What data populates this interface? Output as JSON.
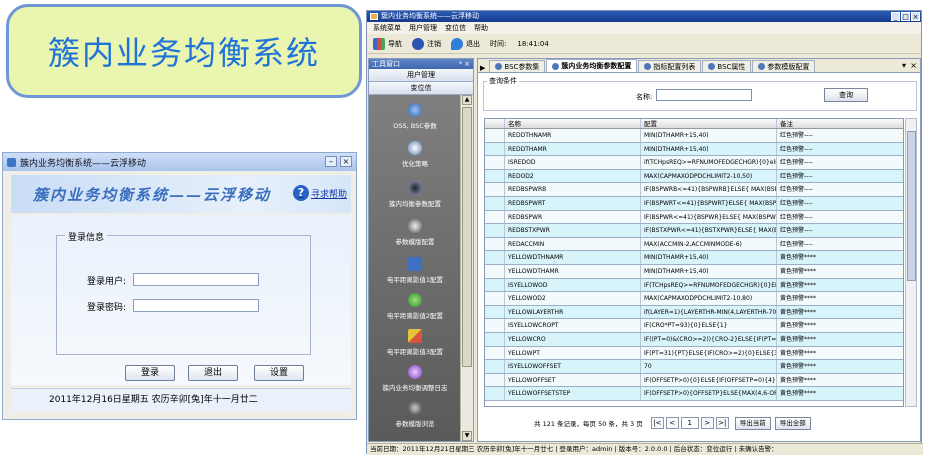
{
  "banner": {
    "title": "簇内业务均衡系统"
  },
  "login": {
    "window_title": "簇内业务均衡系统——云浮移动",
    "header_title": "簇内业务均衡系统——云浮移动",
    "help_label": "寻求帮助",
    "group_title": "登录信息",
    "user_label": "登录用户:",
    "password_label": "登录密码:",
    "buttons": {
      "login": "登录",
      "exit": "退出",
      "settings": "设置"
    },
    "footer_date": "2011年12月16日星期五 农历辛卯[兔]年十一月廿二"
  },
  "main": {
    "window_title": "簇内业务均衡系统——云浮移动",
    "menu": [
      "系统菜单",
      "用户管理",
      "变位信",
      "帮助"
    ],
    "toolbar": {
      "nav": "导航",
      "logout": "注销",
      "exit": "退出",
      "time_label": "时间:",
      "time_value": "18:41:04"
    },
    "sidebar": {
      "header": "工具窗口",
      "tab1": "用户管理",
      "tab2": "变位信",
      "items": [
        "OSS, BSC参数",
        "优化策略",
        "簇内均衡参数配置",
        "参数模版配置",
        "电平距离影值1配置",
        "电平距离影值2配置",
        "电平距离影值3配置",
        "簇内业务均衡调整日志",
        "参数模版浏览"
      ]
    },
    "tabs": [
      "BSC参数集",
      "簇内业务均衡参数配置",
      "指标配置列表",
      "BSC属性",
      "参数模版配置"
    ],
    "query": {
      "legend": "查询条件",
      "name_label": "名称:",
      "button": "查询"
    },
    "columns": [
      "名称",
      "配置",
      "备注"
    ],
    "rows": [
      [
        "REDDTHNAMR",
        "MIN(DTHAMR+15,40)",
        "红色预警----"
      ],
      [
        "REDDTHAMR",
        "MIN(DTHAMR+15,40)",
        "红色预警----"
      ],
      [
        "ISREDOD",
        "if(TCHpsREQ>=RFNUMOFEDGECHGR){0}else{1}",
        "红色预警----"
      ],
      [
        "REDOD2",
        "MAX(CAPMAXODPDCHLIMIT2-10,50)",
        "红色预警----"
      ],
      [
        "REDBSPWRB",
        "IF(BSPWRB<=41){BSPWRB}ELSE{ MAX(BSPW...",
        "红色预警----"
      ],
      [
        "REDBSPWRT",
        "IF(BSPWRT<=41){BSPWRT}ELSE{ MAX(BSPW...",
        "红色预警----"
      ],
      [
        "REDBSPWR",
        "IF(BSPWR<=41){BSPWR}ELSE{ MAX(BSPWR-...",
        "红色预警----"
      ],
      [
        "REDBSTXPWR",
        "IF(BSTXPWR<=41){BSTXPWR}ELSE{ MAX(BST...",
        "红色预警----"
      ],
      [
        "REDACCMIN",
        "MAX(ACCMIN-2,ACCMINMODE-6)",
        "红色预警----"
      ],
      [
        "YELLOWDTHNAMR",
        "MIN(DTHAMR+15,40)",
        "黄色预警****"
      ],
      [
        "YELLOWDTHAMR",
        "MIN(DTHAMR+15,40)",
        "黄色预警****"
      ],
      [
        "ISYELLOWOD",
        "IF(TCHpsREQ>=RFNUMOFEDGECHGR){0}ELS...",
        "黄色预警****"
      ],
      [
        "YELLOWOD2",
        "MAX(CAPMAXODPDCHLIMIT2-10,80)",
        "黄色预警****"
      ],
      [
        "YELLOWLAYERTHR",
        "if(LAYER=1){LAYERTHR-MIN(4,LAYERTHR-70)...",
        "黄色预警****"
      ],
      [
        "ISYELLOWCROPT",
        "IF(CRO*PT=93){0}ELSE{1}",
        "黄色预警****"
      ],
      [
        "YELLOWCRO",
        "IF((PT=0)&(CRO>=2)){CRO-2}ELSE{IF(PT=0)...",
        "黄色预警****"
      ],
      [
        "YELLOWPT",
        "IF(PT=31){PT}ELSE{IF(CRO>=2){0}ELSE{31}}",
        "黄色预警****"
      ],
      [
        "ISYELLOWOFFSET",
        "70",
        "黄色预警****"
      ],
      [
        "YELLOWOFFSET",
        "IF(OFFSETP>0){0}ELSE{IF(OFFSETP=0){4}EL...",
        "黄色预警****"
      ],
      [
        "YELLOWOFFSETSTEP",
        "IF(OFFSETP>0){OFFSETP}ELSE{MAX(4,6-OFF...",
        "黄色预警****"
      ]
    ],
    "pager": {
      "summary": "共 121 条记录，每页 50 条，共 3 页",
      "first": "|<",
      "prev": "<",
      "page": "1",
      "next": ">",
      "last": ">|",
      "export_page": "导出当前",
      "export_all": "导出全部"
    },
    "status": "当前日期：2011年12月21日星期三  农历辛卯[兔]年十一月廿七  |  登录用户：admin  |  版本号：2.0.0.0  |  后台状态：变位运行  |  未确认告警："
  }
}
